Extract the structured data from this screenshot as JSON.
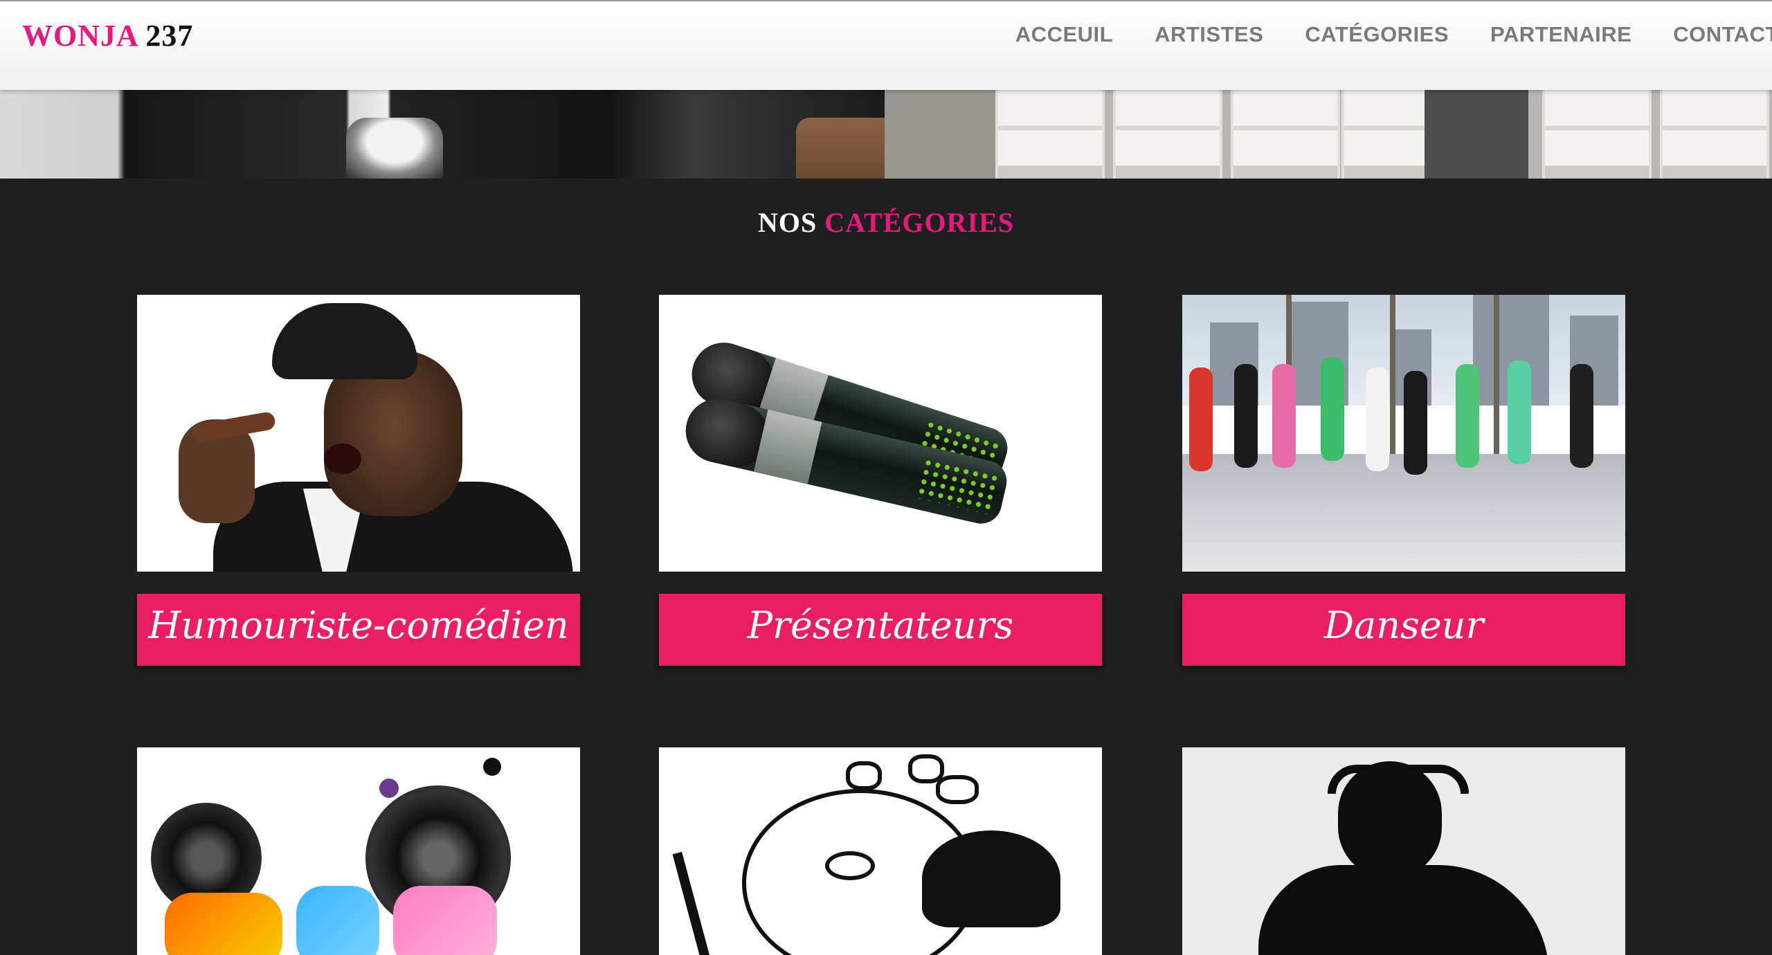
{
  "brand": {
    "part1": "WONJA",
    "part2": "237"
  },
  "nav": {
    "items": [
      "ACCEUIL",
      "ARTISTES",
      "CATÉGORIES",
      "PARTENAIRE",
      "CONTACT"
    ]
  },
  "section": {
    "title_part1": "NOS",
    "title_part2": "CATÉGORIES"
  },
  "categories": [
    {
      "label": "Humouriste-comédien",
      "image": "comedian-photo"
    },
    {
      "label": "Présentateurs",
      "image": "microphones-photo"
    },
    {
      "label": "Danseur",
      "image": "dancers-photo"
    },
    {
      "label": "",
      "image": "music-art"
    },
    {
      "label": "",
      "image": "magician-drawing"
    },
    {
      "label": "",
      "image": "dj-silhouette"
    }
  ],
  "colors": {
    "accent": "#e91e63",
    "brand_pink": "#e8197c",
    "background": "#1f1f1f"
  }
}
